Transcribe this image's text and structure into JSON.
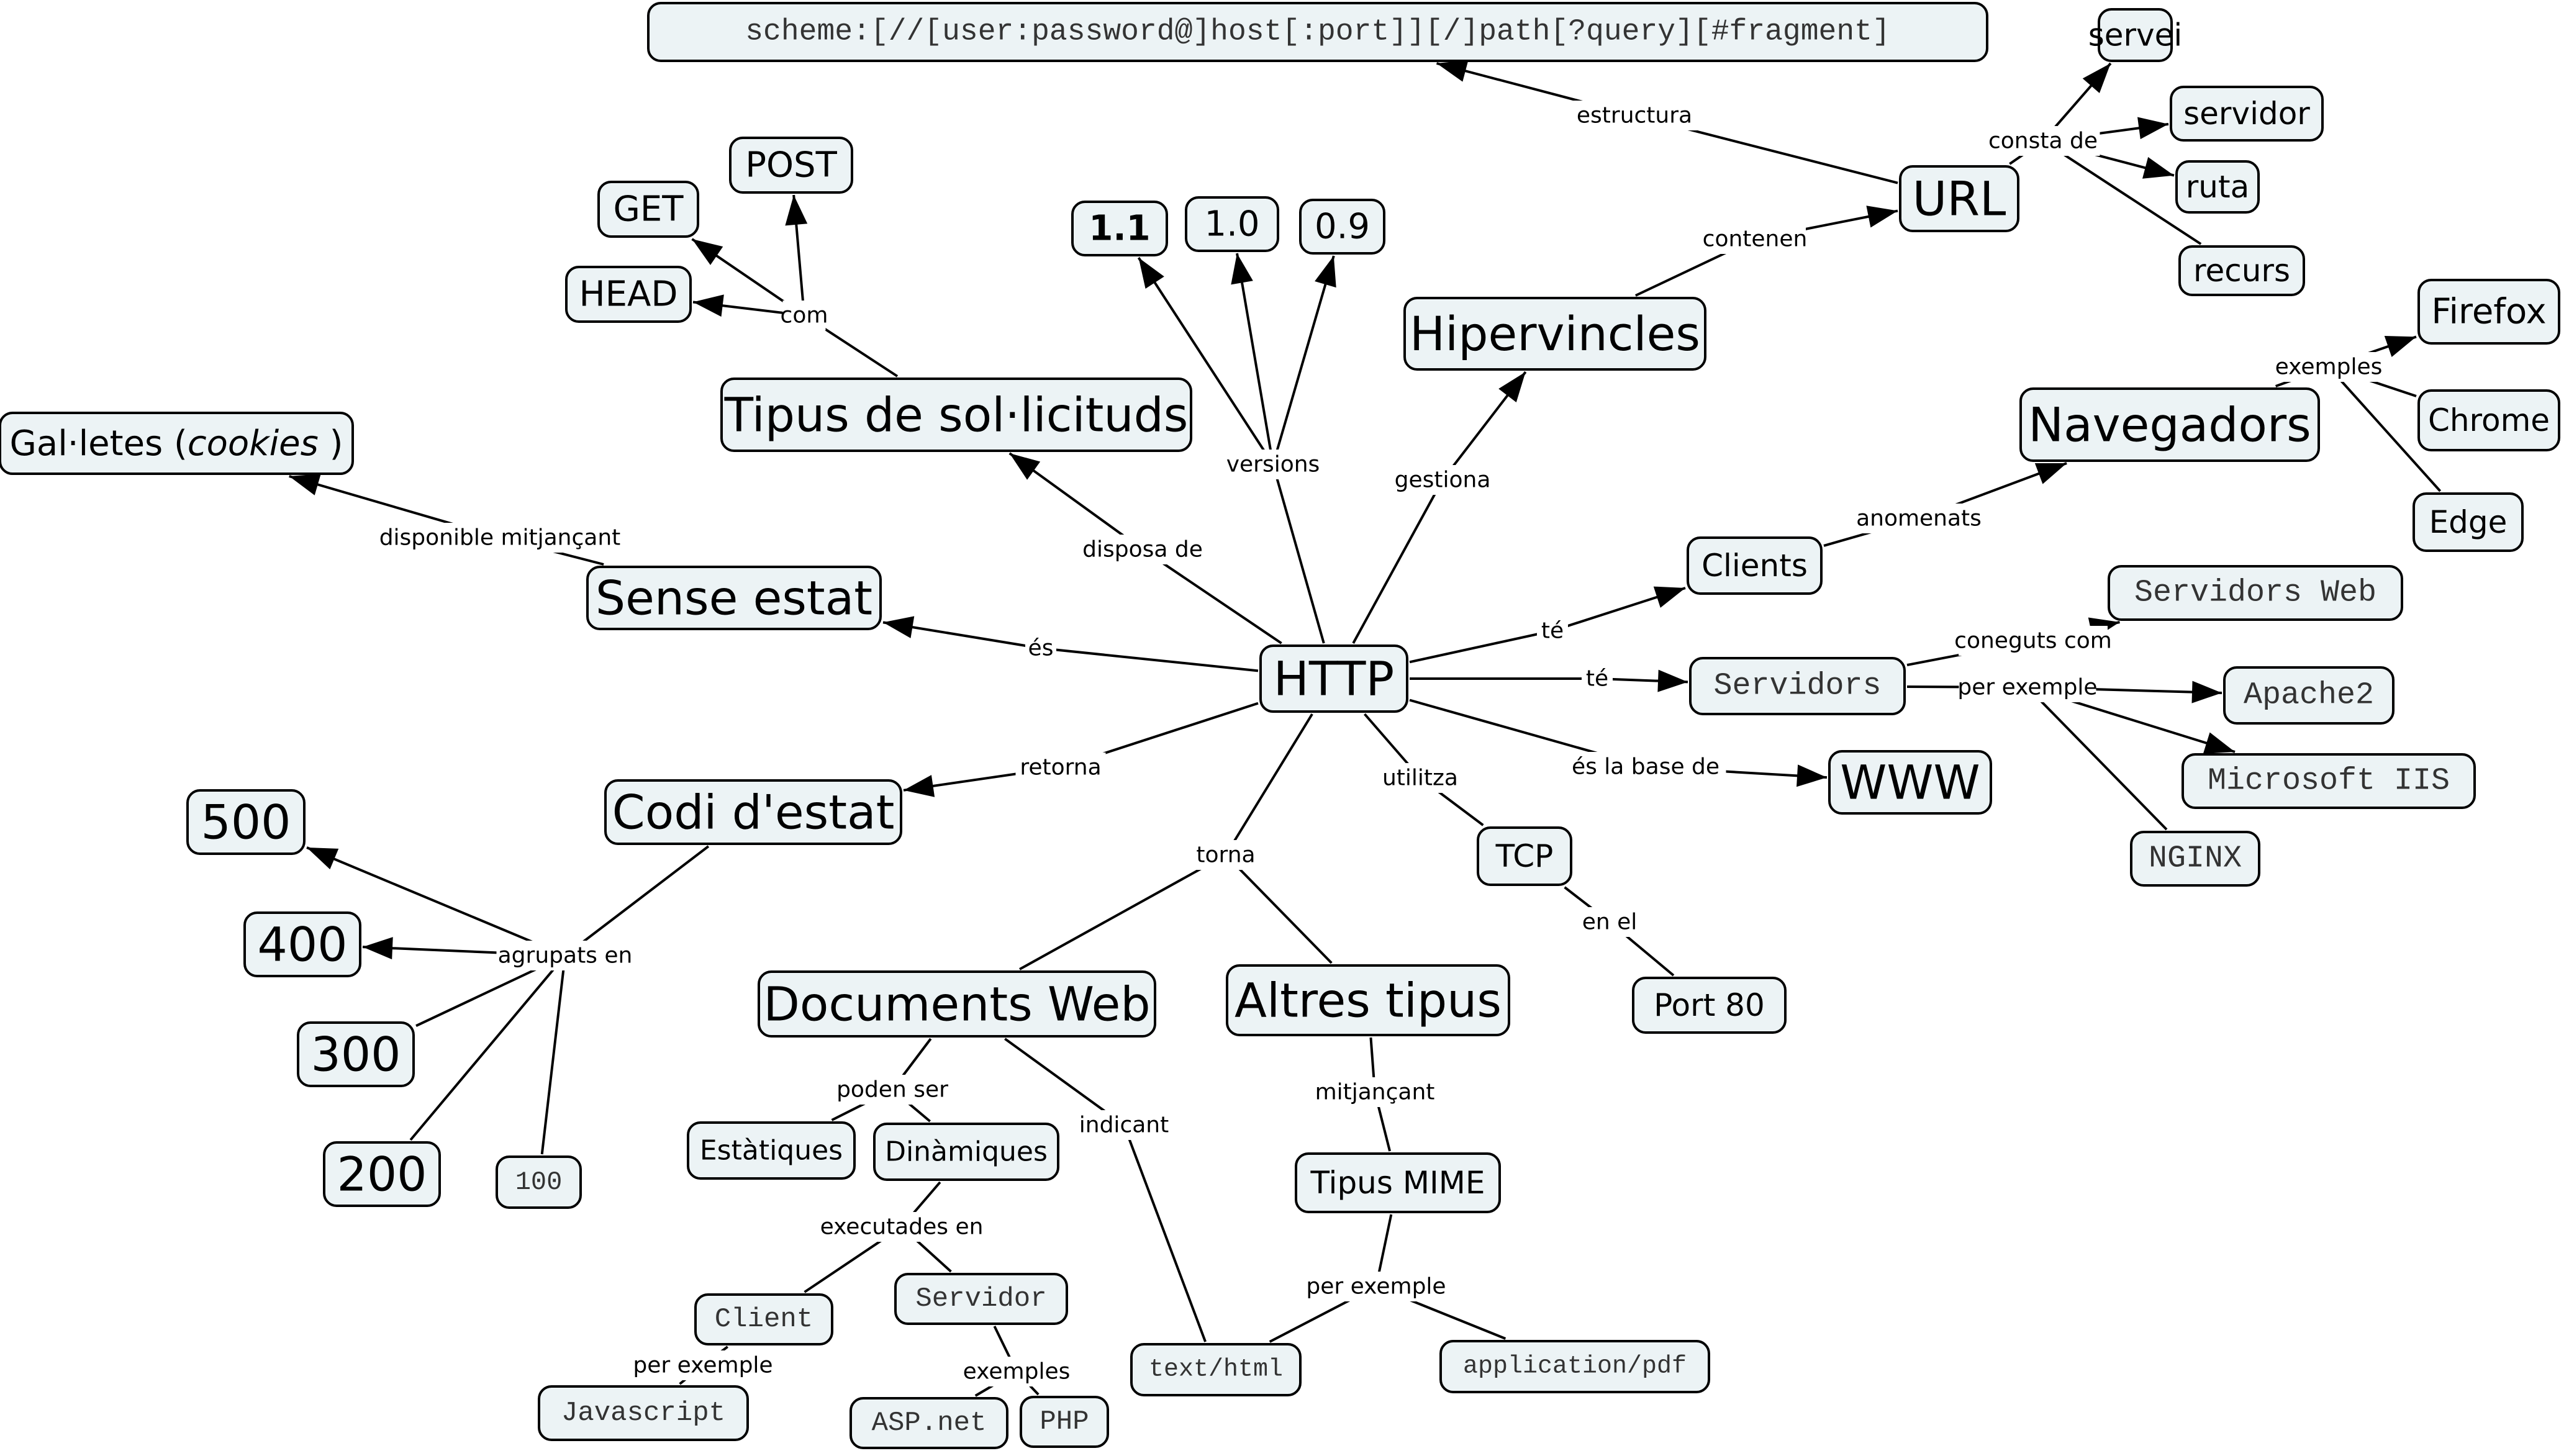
{
  "title": "HTTP",
  "nodes": {
    "http": "HTTP",
    "url_format": "scheme:[//[user:password@]host[:port]][/]path[?query][#fragment]",
    "url": "URL",
    "servei": "servei",
    "servidor": "servidor",
    "ruta": "ruta",
    "recurs": "recurs",
    "hipervincles": "Hipervincles",
    "navegadors": "Navegadors",
    "firefox": "Firefox",
    "chrome": "Chrome",
    "edge": "Edge",
    "clients": "Clients",
    "servidors": "Servidors",
    "servidors_web": "Servidors Web",
    "apache2": "Apache2",
    "iis": "Microsoft IIS",
    "nginx": "NGINX",
    "www": "WWW",
    "tcp": "TCP",
    "port80": "Port 80",
    "v11": "1.1",
    "v10": "1.0",
    "v09": "0.9",
    "tipus_sol": "Tipus de sol·licituds",
    "get": "GET",
    "post": "POST",
    "head": "HEAD",
    "galetes_pre": "Gal·letes (",
    "galetes_em": "cookies",
    "galetes_post": " )",
    "sense_estat": "Sense estat",
    "codi_estat": "Codi d'estat",
    "c500": "500",
    "c400": "400",
    "c300": "300",
    "c200": "200",
    "c100": "100",
    "documents_web": "Documents Web",
    "altres_tipus": "Altres tipus",
    "estatiques": "Estàtiques",
    "dinamiques": "Dinàmiques",
    "client": "Client",
    "servidor2": "Servidor",
    "javascript": "Javascript",
    "aspnet": "ASP.net",
    "php": "PHP",
    "tipus_mime": "Tipus MIME",
    "text_html": "text/html",
    "app_pdf": "application/pdf"
  },
  "links": {
    "estructura": "estructura",
    "consta_de": "consta de",
    "contenen": "contenen",
    "exemples_nav": "exemples",
    "anomenats": "anomenats",
    "te_clients": "té",
    "te_servidors": "té",
    "coneguts_com": "coneguts com",
    "per_exemple_srv": "per exemple",
    "es_base": "és la base de",
    "utilitza": "utilitza",
    "en_el": "en el",
    "gestiona": "gestiona",
    "versions": "versions",
    "disposa_de": "disposa de",
    "com": "com",
    "disponible": "disponible mitjançant",
    "es": "és",
    "retorna": "retorna",
    "agrupats": "agrupats en",
    "torna": "torna",
    "poden_ser": "poden ser",
    "indicant": "indicant",
    "executades": "executades en",
    "per_exemple_cli": "per exemple",
    "exemples_srv": "exemples",
    "mitjancant": "mitjançant",
    "per_exemple_mime": "per exemple"
  }
}
